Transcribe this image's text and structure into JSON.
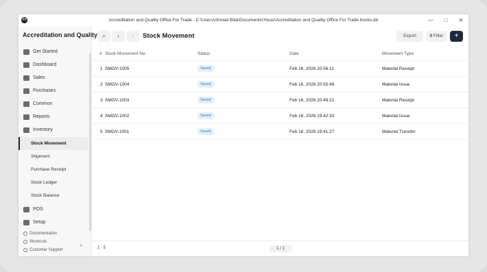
{
  "window": {
    "title": "Accreditation and Quality Office For Trade - C:\\Users\\Ahmad Bilal\\Documents\\Yousr\\Accreditation and Quality Office For Trade books.db",
    "app_icon_text": "AB",
    "controls": {
      "minimize": "—",
      "maximize": "□",
      "close": "✕"
    }
  },
  "sidebar": {
    "company": "Accreditation and Quality",
    "items": [
      {
        "label": "Get Started",
        "icon": "rocket-icon"
      },
      {
        "label": "Dashboard",
        "icon": "dashboard-icon"
      },
      {
        "label": "Sales",
        "icon": "sales-icon"
      },
      {
        "label": "Purchases",
        "icon": "purchases-icon"
      },
      {
        "label": "Common",
        "icon": "common-icon"
      },
      {
        "label": "Reports",
        "icon": "reports-icon"
      },
      {
        "label": "Inventory",
        "icon": "inventory-icon"
      },
      {
        "label": "Stock Movement",
        "sub": true,
        "active": true
      },
      {
        "label": "Shipment",
        "sub": true
      },
      {
        "label": "Purchase Receipt",
        "sub": true
      },
      {
        "label": "Stock Ledger",
        "sub": true
      },
      {
        "label": "Stock Balance",
        "sub": true
      },
      {
        "label": "POS",
        "icon": "pos-icon"
      },
      {
        "label": "Setup",
        "icon": "setup-icon"
      }
    ],
    "footer": {
      "documentation": "Documentation",
      "shortcuts": "Shortcuts",
      "support": "Customer Support",
      "collapse": "«"
    }
  },
  "toolbar": {
    "search_icon": "⌕",
    "back_icon": "‹",
    "forward_icon": "›",
    "title": "Stock Movement",
    "export_label": "Export",
    "filter_label": "Filter",
    "add_label": "+"
  },
  "table": {
    "columns": [
      "#",
      "Stock Movement No.",
      "Status",
      "Date",
      "Movement Type"
    ],
    "rows": [
      {
        "idx": "1",
        "no": "SMOV-1005",
        "status": "Saved",
        "date": "Feb 16, 2026 20:56:11",
        "type": "Material Receipt"
      },
      {
        "idx": "2",
        "no": "SMOV-1004",
        "status": "Saved",
        "date": "Feb 16, 2026 20:55:46",
        "type": "Material Issue"
      },
      {
        "idx": "3",
        "no": "SMOV-1003",
        "status": "Saved",
        "date": "Feb 16, 2026 20:49:21",
        "type": "Material Receipt"
      },
      {
        "idx": "4",
        "no": "SMOV-1002",
        "status": "Saved",
        "date": "Feb 16, 2026 19:42:32",
        "type": "Material Issue"
      },
      {
        "idx": "5",
        "no": "SMOV-1001",
        "status": "Saved",
        "date": "Feb 16, 2026 19:41:27",
        "type": "Material Transfer"
      }
    ]
  },
  "footer": {
    "count": "1 - 5",
    "page": "1 / 1"
  },
  "colors": {
    "accent": "#1e2a3b",
    "badge_bg": "#e3f0fb",
    "badge_text": "#2f7bbf"
  }
}
